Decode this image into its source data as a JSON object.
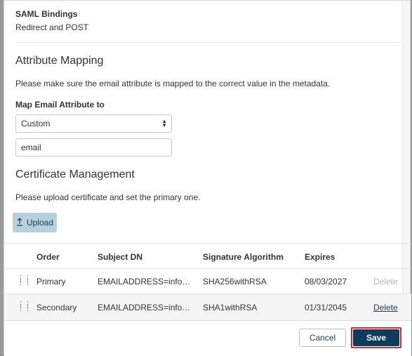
{
  "saml": {
    "label": "SAML Bindings",
    "value": "Redirect and POST"
  },
  "attribute_mapping": {
    "heading": "Attribute Mapping",
    "description": "Please make sure the email attribute is mapped to the correct value in the metadata.",
    "map_label": "Map Email Attribute to",
    "select_value": "Custom",
    "input_value": "email"
  },
  "certificates": {
    "heading": "Certificate Management",
    "description": "Please upload certificate and set the primary one.",
    "upload_label": "Upload",
    "columns": [
      "Order",
      "Subject DN",
      "Signature Algorithm",
      "Expires"
    ],
    "rows": [
      {
        "order": "Primary",
        "subject": "EMAILADDRESS=info@okt…",
        "algorithm": "SHA256withRSA",
        "expires": "08/03/2027",
        "action": "Delete",
        "action_enabled": false
      },
      {
        "order": "Secondary",
        "subject": "EMAILADDRESS=info@okt…",
        "algorithm": "SHA1withRSA",
        "expires": "01/31/2045",
        "action": "Delete",
        "action_enabled": true
      }
    ]
  },
  "footer": {
    "cancel_label": "Cancel",
    "save_label": "Save"
  },
  "icons": {
    "upload": "upload-icon",
    "drag": "drag-handle-icon",
    "select": "select-arrows-icon"
  },
  "colors": {
    "primary": "#0e3a5c",
    "upload_bg": "#b6d0de",
    "highlight": "#d72631"
  }
}
